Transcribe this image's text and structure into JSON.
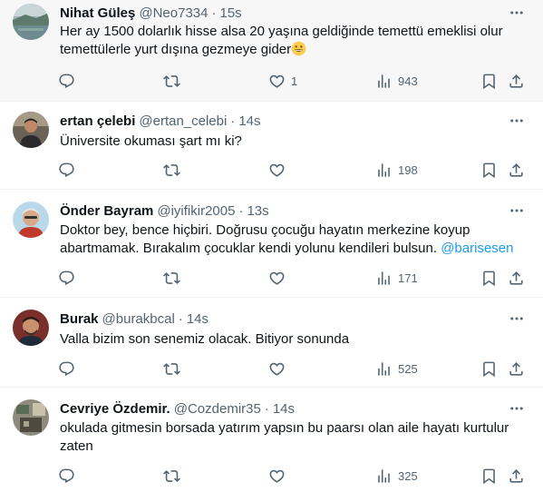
{
  "tweets": [
    {
      "name": "Nihat Güleş",
      "handle": "@Neo7334",
      "separator": "·",
      "time": "15s",
      "text": "Her ay 1500 dolarlık hisse alsa 20 yaşına geldiğinde temettü emeklisi olur temettülerle yurt dışına gezmeye gider",
      "emoji": "😄",
      "replies": "",
      "retweets": "",
      "likes": "1",
      "views": "943",
      "highlighted": true
    },
    {
      "name": "ertan çelebi",
      "handle": "@ertan_celebi",
      "separator": "·",
      "time": "14s",
      "text": "Üniversite okuması şart mı ki?",
      "replies": "",
      "retweets": "",
      "likes": "",
      "views": "198"
    },
    {
      "name": "Önder Bayram",
      "handle": "@iyifikir2005",
      "separator": "·",
      "time": "13s",
      "text": "Doktor bey, bence hiçbiri. Doğrusu çocuğu hayatın merkezine koyup abartmamak. Bırakalım çocuklar kendi yolunu kendileri bulsun.",
      "mention": "@barisesen",
      "replies": "",
      "retweets": "",
      "likes": "",
      "views": "171"
    },
    {
      "name": "Burak",
      "handle": "@burakbcal",
      "separator": "·",
      "time": "14s",
      "text": "Valla bizim son senemiz olacak. Bitiyor sonunda",
      "replies": "",
      "retweets": "",
      "likes": "",
      "views": "525"
    },
    {
      "name": "Cevriye Özdemir.",
      "handle": "@Cozdemir35",
      "separator": "·",
      "time": "14s",
      "text": "okulada gitmesin borsada yatırım yapsın bu paarsı olan aile hayatı kurtulur zaten",
      "replies": "",
      "retweets": "",
      "likes": "",
      "views": "325"
    }
  ],
  "icons": {
    "more": "more-icon",
    "reply": "reply-icon",
    "retweet": "retweet-icon",
    "like": "like-icon",
    "views": "views-icon",
    "bookmark": "bookmark-icon",
    "share": "share-icon"
  },
  "colors": {
    "text": "#0f1419",
    "secondary": "#536471",
    "mention": "#1d9bf0",
    "highlight_bg": "#f7f7f7",
    "divider": "#eff3f4"
  }
}
